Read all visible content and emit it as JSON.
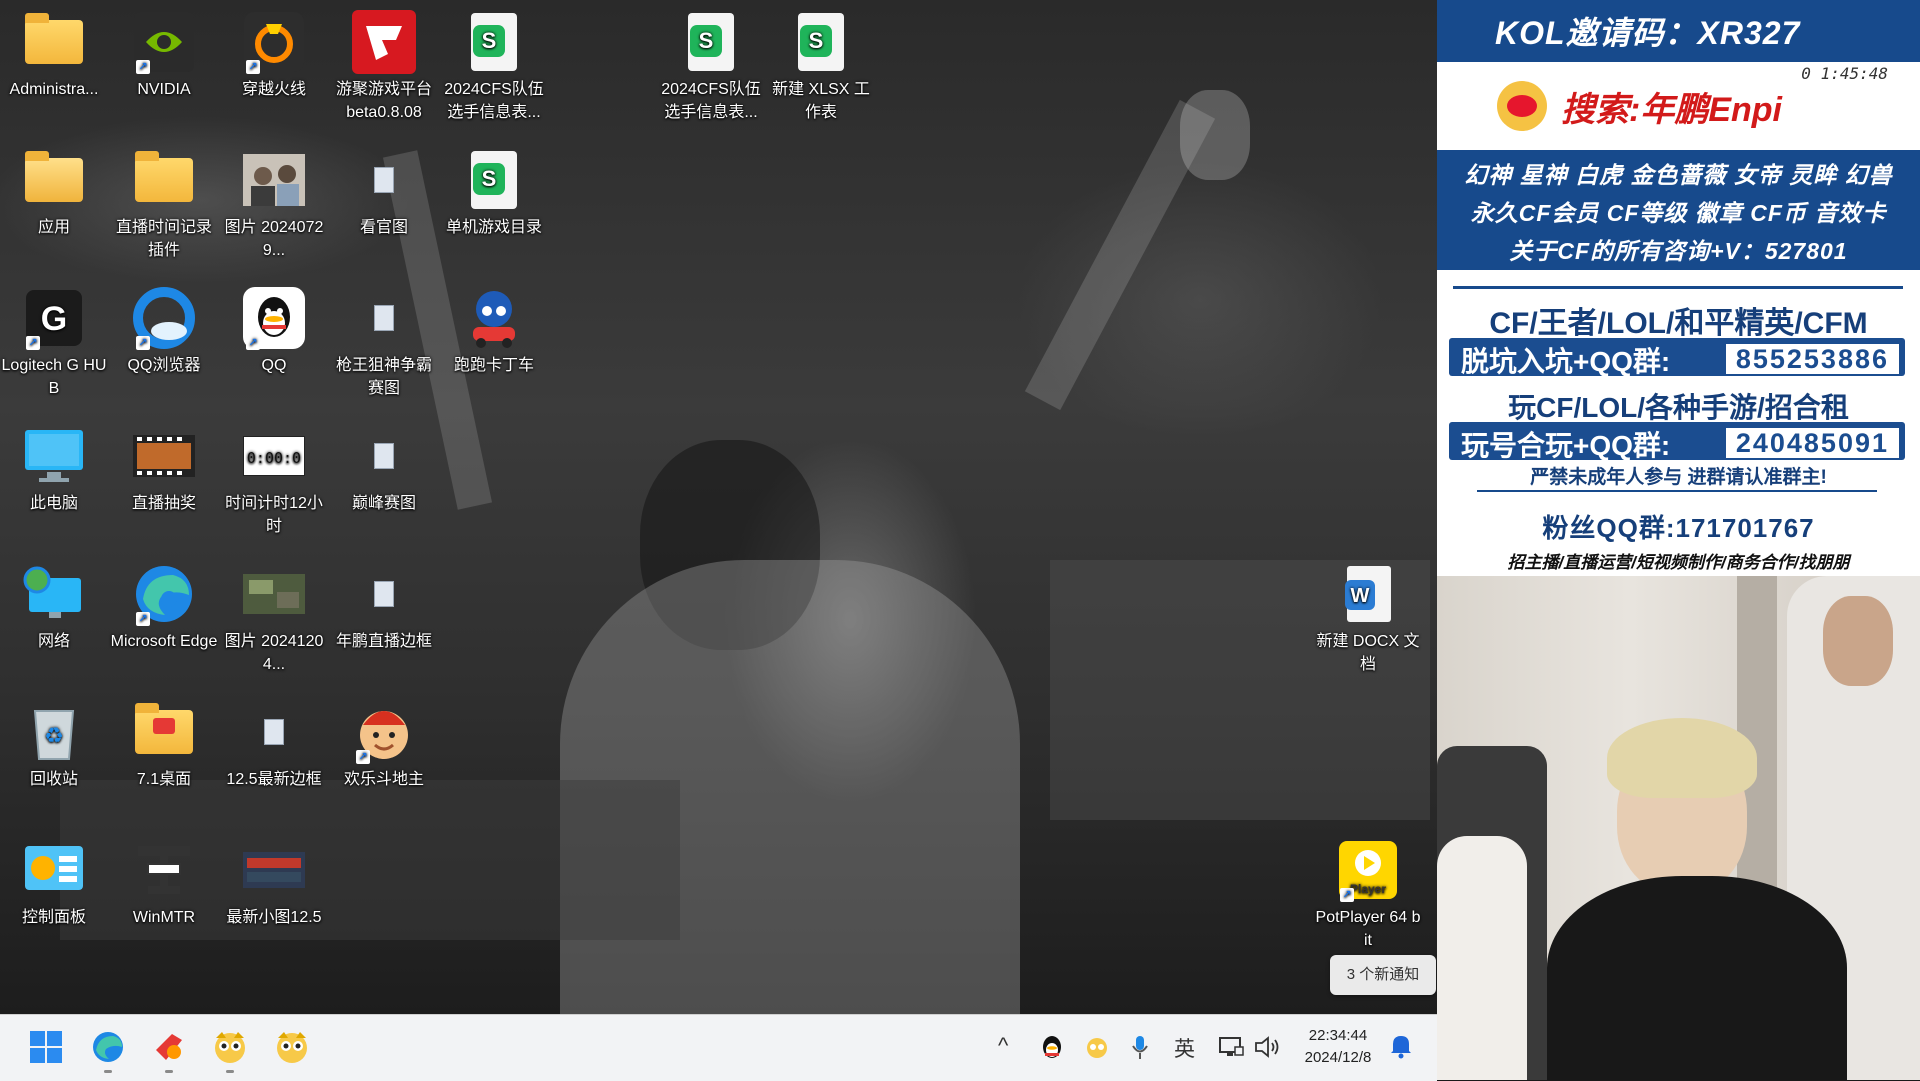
{
  "desktop_icons": [
    {
      "label": "Administra...",
      "icon": "folder-icon"
    },
    {
      "label": "NVIDIA",
      "icon": "nvidia-icon"
    },
    {
      "label": "穿越火线",
      "icon": "crossfire-icon"
    },
    {
      "label": "游聚游戏平台 beta0.8.08",
      "icon": "youju-platform-icon"
    },
    {
      "label": "2024CFS队伍选手信息表...",
      "icon": "spreadsheet-icon"
    },
    {
      "label": "2024CFS队伍选手信息表...",
      "icon": "spreadsheet-icon"
    },
    {
      "label": "新建 XLSX 工作表",
      "icon": "spreadsheet-icon"
    },
    {
      "label": "应用",
      "icon": "folder-icon"
    },
    {
      "label": "直播时间记录插件",
      "icon": "folder-icon"
    },
    {
      "label": "图片 20240729...",
      "icon": "image-icon"
    },
    {
      "label": "看官图",
      "icon": "file-icon"
    },
    {
      "label": "单机游戏目录",
      "icon": "spreadsheet-icon"
    },
    {
      "label": "Logitech G HUB",
      "icon": "logitech-icon"
    },
    {
      "label": "QQ浏览器",
      "icon": "qq-browser-icon"
    },
    {
      "label": "QQ",
      "icon": "qq-icon"
    },
    {
      "label": "枪王狙神争霸赛图",
      "icon": "file-icon"
    },
    {
      "label": "跑跑卡丁车",
      "icon": "kartrider-icon"
    },
    {
      "label": "此电脑",
      "icon": "computer-icon"
    },
    {
      "label": "直播抽奖",
      "icon": "video-icon"
    },
    {
      "label": "时间计时12小时",
      "icon": "timer-icon"
    },
    {
      "label": "巅峰赛图",
      "icon": "file-icon"
    },
    {
      "label": "网络",
      "icon": "network-icon"
    },
    {
      "label": "Microsoft Edge",
      "icon": "edge-icon"
    },
    {
      "label": "图片 20241204...",
      "icon": "image-icon"
    },
    {
      "label": "年鹏直播边框",
      "icon": "file-icon"
    },
    {
      "label": "新建 DOCX 文档",
      "icon": "word-document-icon"
    },
    {
      "label": "回收站",
      "icon": "recycle-bin-icon"
    },
    {
      "label": "7.1桌面",
      "icon": "folder-icon"
    },
    {
      "label": "12.5最新边框",
      "icon": "file-icon"
    },
    {
      "label": "欢乐斗地主",
      "icon": "doudizhu-icon"
    },
    {
      "label": "控制面板",
      "icon": "control-panel-icon"
    },
    {
      "label": "WinMTR",
      "icon": "winmtr-icon"
    },
    {
      "label": "最新小图12.5",
      "icon": "image-icon"
    },
    {
      "label": "PotPlayer 64 bit",
      "icon": "potplayer-icon"
    }
  ],
  "taskbar": {
    "apps": [
      "start-icon",
      "edge-icon",
      "browser-icon",
      "game-app-icon",
      "game-app-icon"
    ],
    "tray": {
      "chevron": "^",
      "ime": "英"
    },
    "clock": {
      "time": "22:34:44",
      "date": "2024/12/8"
    },
    "notification_toast": "3 个新通知"
  },
  "panel": {
    "kol_code": "KOL邀请码：XR327",
    "timer": "0 1:45:48",
    "weibo_search": "搜索:年鹏Enpi",
    "blue_lines": [
      "幻神 星神 白虎 金色蔷薇 女帝 灵眸 幻兽",
      "永久CF会员 CF等级 徽章 CF币 音效卡",
      "关于CF的所有咨询+V：527801"
    ],
    "games_line": "CF/王者/LOL/和平精英/CFM",
    "qq_group_1": {
      "label": "脱坑入坑+QQ群:",
      "number": "855253886"
    },
    "play_line": "玩CF/LOL/各种手游/招合租",
    "qq_group_2": {
      "label": "玩号合玩+QQ群:",
      "number": "240485091"
    },
    "minor_notice": "严禁未成年人参与  进群请认准群主!",
    "fan_group": "粉丝QQ群:171701767",
    "recruit_line": "招主播/直播运营/短视频制作/商务合作/找朋朋"
  },
  "colors": {
    "panel_blue": "#174a8c",
    "weibo_red": "#d21a1a",
    "taskbar_bg": "#f2f3f5"
  }
}
